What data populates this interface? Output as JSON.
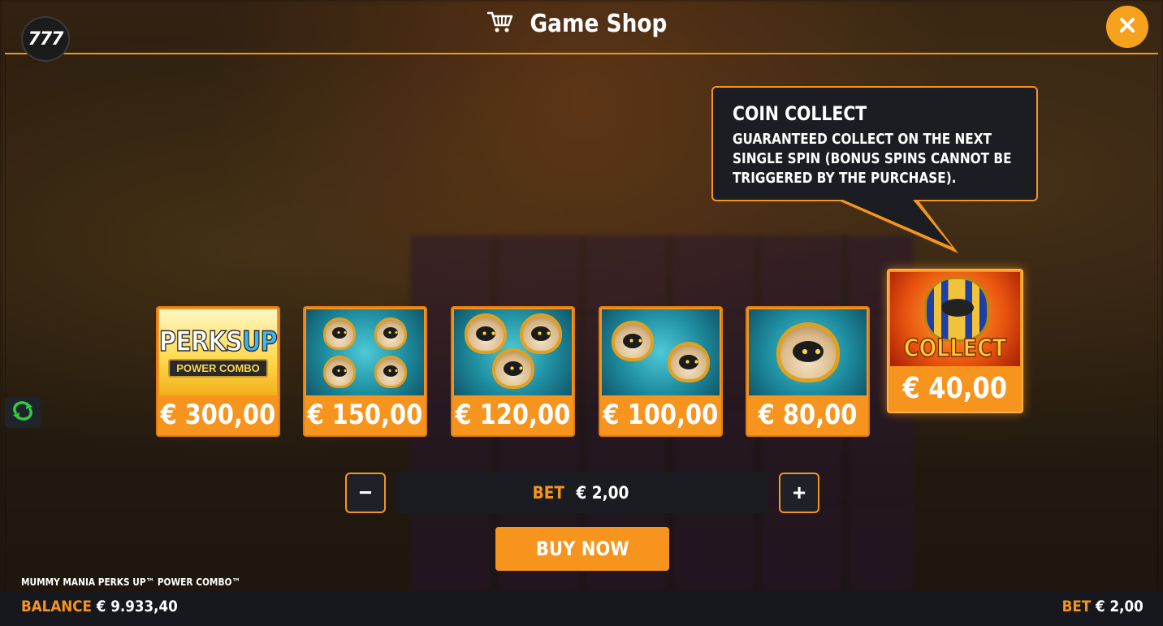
{
  "header": {
    "logo_text": "777",
    "title": "Game Shop",
    "cart_icon": "cart-icon",
    "close_icon": "close-icon"
  },
  "tooltip": {
    "title": "COIN COLLECT",
    "text": "GUARANTEED COLLECT ON THE NEXT SINGLE SPIN (BONUS SPINS CANNOT BE TRIGGERED BY THE PURCHASE)."
  },
  "shop": {
    "items": [
      {
        "art": "PERKS UP POWER COMBO",
        "art_word1": "PERKS",
        "art_word2": "UP",
        "art_sub": "POWER COMBO",
        "price": "€ 300,00"
      },
      {
        "art": "4 mummies",
        "price": "€ 150,00"
      },
      {
        "art": "3 mummies",
        "price": "€ 120,00"
      },
      {
        "art": "2 mummies",
        "price": "€ 100,00"
      },
      {
        "art": "1 mummy",
        "price": "€ 80,00"
      },
      {
        "art": "COLLECT",
        "art_word": "COLLECT",
        "price": "€ 40,00",
        "selected": true
      }
    ]
  },
  "bet": {
    "label": "BET",
    "value": "€ 2,00",
    "decrease_label": "−",
    "increase_label": "+"
  },
  "buy_button": "BUY NOW",
  "game_name": "MUMMY MANIA PERKS UP™ POWER COMBO™",
  "footer": {
    "balance_label": "BALANCE",
    "balance_value": "€ 9.933,40",
    "bet_label": "BET",
    "bet_value": "€ 2,00"
  },
  "colors": {
    "accent": "#f7941d",
    "panel": "#1b1d23",
    "close": "#f7a21d"
  }
}
